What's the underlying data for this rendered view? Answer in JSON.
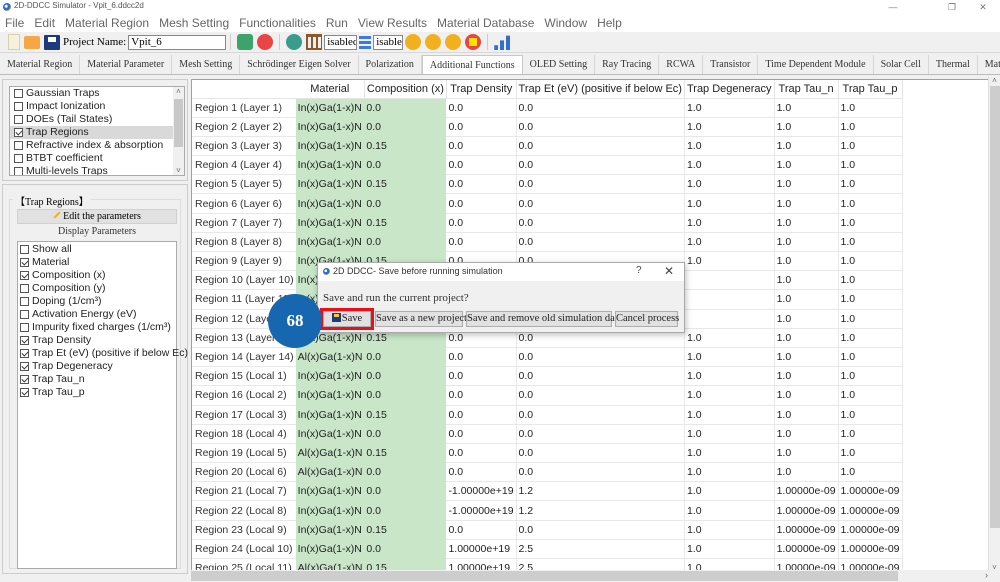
{
  "window": {
    "title": "2D-DDCC Simulator - Vpit_6.ddcc2d",
    "controls": {
      "minimize": "—",
      "maximize": "❐",
      "close": "✕"
    }
  },
  "menu": [
    "File",
    "Edit",
    "Material Region",
    "Mesh Setting",
    "Functionalities",
    "Run",
    "View Results",
    "Material Database",
    "Window",
    "Help"
  ],
  "toolbar": {
    "project_name_label": "Project Name:",
    "project_name_value": "Vpit_6",
    "dropdown1_value": "isabled",
    "dropdown2_value": "isabled",
    "icons": [
      "new-file-icon",
      "open-folder-icon",
      "save-icon",
      "refresh-mesh-icon",
      "reload-icon",
      "settings-icon",
      "parallel-icon",
      "list-icon",
      "run-icon",
      "run-all-icon",
      "run-batch-icon",
      "stop-icon",
      "chart-icon"
    ]
  },
  "tabs": [
    {
      "label": "Material Region",
      "active": false
    },
    {
      "label": "Material Parameter",
      "active": false
    },
    {
      "label": "Mesh Setting",
      "active": false
    },
    {
      "label": "Schrödinger Eigen Solver",
      "active": false
    },
    {
      "label": "Polarization",
      "active": false
    },
    {
      "label": "Additional Functions",
      "active": true
    },
    {
      "label": "OLED Setting",
      "active": false
    },
    {
      "label": "Ray Tracing",
      "active": false
    },
    {
      "label": "RCWA",
      "active": false
    },
    {
      "label": "Transistor",
      "active": false
    },
    {
      "label": "Time Dependent Module",
      "active": false
    },
    {
      "label": "Solar Cell",
      "active": false
    },
    {
      "label": "Thermal",
      "active": false
    },
    {
      "label": "Material Database",
      "active": false
    }
  ],
  "functions_list": [
    {
      "label": "Gaussian Traps",
      "checked": false,
      "selected": false
    },
    {
      "label": "Impact Ionization",
      "checked": false,
      "selected": false
    },
    {
      "label": "DOEs (Tail States)",
      "checked": false,
      "selected": false
    },
    {
      "label": "Trap Regions",
      "checked": true,
      "selected": true
    },
    {
      "label": "Refractive index & absorption",
      "checked": false,
      "selected": false
    },
    {
      "label": "BTBT coefficient",
      "checked": false,
      "selected": false
    },
    {
      "label": "Multi-levels Traps",
      "checked": false,
      "selected": false
    }
  ],
  "trap_panel": {
    "group_title": "【Trap Regions】",
    "edit_button": "Edit the parameters",
    "display_label": "Display Parameters",
    "display_params": [
      {
        "label": "Show all",
        "checked": false
      },
      {
        "label": "Material",
        "checked": true
      },
      {
        "label": "Composition (x)",
        "checked": true
      },
      {
        "label": "Composition (y)",
        "checked": false
      },
      {
        "label": "Doping (1/cm³)",
        "checked": false
      },
      {
        "label": "Activation Energy (eV)",
        "checked": false
      },
      {
        "label": "Impurity fixed charges (1/cm³)",
        "checked": false
      },
      {
        "label": "Trap Density",
        "checked": true
      },
      {
        "label": "Trap Et (eV) (positive if below Ec)",
        "checked": true
      },
      {
        "label": "Trap Degeneracy",
        "checked": true
      },
      {
        "label": "Trap Tau_n",
        "checked": true
      },
      {
        "label": "Trap Tau_p",
        "checked": true
      }
    ]
  },
  "table": {
    "columns": [
      "Material",
      "Composition (x)",
      "Trap Density",
      "Trap Et (eV) (positive if below Ec)",
      "Trap Degeneracy",
      "Trap Tau_n",
      "Trap Tau_p"
    ],
    "rows": [
      {
        "label": "Region 1 (Layer 1)",
        "cells": [
          "In(x)Ga(1-x)N",
          "0.0",
          "0.0",
          "0.0",
          "1.0",
          "1.0",
          "1.0"
        ]
      },
      {
        "label": "Region 2 (Layer 2)",
        "cells": [
          "In(x)Ga(1-x)N",
          "0.0",
          "0.0",
          "0.0",
          "1.0",
          "1.0",
          "1.0"
        ]
      },
      {
        "label": "Region 3 (Layer 3)",
        "cells": [
          "In(x)Ga(1-x)N",
          "0.15",
          "0.0",
          "0.0",
          "1.0",
          "1.0",
          "1.0"
        ]
      },
      {
        "label": "Region 4 (Layer 4)",
        "cells": [
          "In(x)Ga(1-x)N",
          "0.0",
          "0.0",
          "0.0",
          "1.0",
          "1.0",
          "1.0"
        ]
      },
      {
        "label": "Region 5 (Layer 5)",
        "cells": [
          "In(x)Ga(1-x)N",
          "0.15",
          "0.0",
          "0.0",
          "1.0",
          "1.0",
          "1.0"
        ]
      },
      {
        "label": "Region 6 (Layer 6)",
        "cells": [
          "In(x)Ga(1-x)N",
          "0.0",
          "0.0",
          "0.0",
          "1.0",
          "1.0",
          "1.0"
        ]
      },
      {
        "label": "Region 7 (Layer 7)",
        "cells": [
          "In(x)Ga(1-x)N",
          "0.15",
          "0.0",
          "0.0",
          "1.0",
          "1.0",
          "1.0"
        ]
      },
      {
        "label": "Region 8 (Layer 8)",
        "cells": [
          "In(x)Ga(1-x)N",
          "0.0",
          "0.0",
          "0.0",
          "1.0",
          "1.0",
          "1.0"
        ]
      },
      {
        "label": "Region 9 (Layer 9)",
        "cells": [
          "In(x)Ga(1-x)N",
          "0.15",
          "0.0",
          "0.0",
          "1.0",
          "1.0",
          "1.0"
        ]
      },
      {
        "label": "Region 10 (Layer 10)",
        "cells": [
          "In(x)Ga(1-x)N",
          "",
          "",
          "",
          "",
          "1.0",
          "1.0"
        ]
      },
      {
        "label": "Region 11 (Layer 11)",
        "cells": [
          "In(x)Ga(1-x)N",
          "",
          "",
          "",
          "",
          "1.0",
          "1.0"
        ]
      },
      {
        "label": "Region 12 (Layer 12)",
        "cells": [
          "In(x)Ga(1-x)N",
          "",
          "",
          "",
          "",
          "1.0",
          "1.0"
        ]
      },
      {
        "label": "Region 13 (Layer 13)",
        "cells": [
          "In(x)Ga(1-x)N",
          "0.15",
          "0.0",
          "0.0",
          "1.0",
          "1.0",
          "1.0"
        ]
      },
      {
        "label": "Region 14 (Layer 14)",
        "cells": [
          "Al(x)Ga(1-x)N",
          "0.0",
          "0.0",
          "0.0",
          "1.0",
          "1.0",
          "1.0"
        ]
      },
      {
        "label": "Region 15 (Local 1)",
        "cells": [
          "In(x)Ga(1-x)N",
          "0.0",
          "0.0",
          "0.0",
          "1.0",
          "1.0",
          "1.0"
        ]
      },
      {
        "label": "Region 16 (Local 2)",
        "cells": [
          "In(x)Ga(1-x)N",
          "0.0",
          "0.0",
          "0.0",
          "1.0",
          "1.0",
          "1.0"
        ]
      },
      {
        "label": "Region 17 (Local 3)",
        "cells": [
          "In(x)Ga(1-x)N",
          "0.15",
          "0.0",
          "0.0",
          "1.0",
          "1.0",
          "1.0"
        ]
      },
      {
        "label": "Region 18 (Local 4)",
        "cells": [
          "In(x)Ga(1-x)N",
          "0.0",
          "0.0",
          "0.0",
          "1.0",
          "1.0",
          "1.0"
        ]
      },
      {
        "label": "Region 19 (Local 5)",
        "cells": [
          "Al(x)Ga(1-x)N",
          "0.15",
          "0.0",
          "0.0",
          "1.0",
          "1.0",
          "1.0"
        ]
      },
      {
        "label": "Region 20 (Local 6)",
        "cells": [
          "Al(x)Ga(1-x)N",
          "0.0",
          "0.0",
          "0.0",
          "1.0",
          "1.0",
          "1.0"
        ]
      },
      {
        "label": "Region 21 (Local 7)",
        "cells": [
          "In(x)Ga(1-x)N",
          "0.0",
          "-1.00000e+19",
          "1.2",
          "1.0",
          "1.00000e-09",
          "1.00000e-09"
        ]
      },
      {
        "label": "Region 22 (Local 8)",
        "cells": [
          "In(x)Ga(1-x)N",
          "0.0",
          "-1.00000e+19",
          "1.2",
          "1.0",
          "1.00000e-09",
          "1.00000e-09"
        ]
      },
      {
        "label": "Region 23 (Local 9)",
        "cells": [
          "In(x)Ga(1-x)N",
          "0.15",
          "0.0",
          "0.0",
          "1.0",
          "1.00000e-09",
          "1.00000e-09"
        ]
      },
      {
        "label": "Region 24 (Local 10)",
        "cells": [
          "In(x)Ga(1-x)N",
          "0.0",
          "1.00000e+19",
          "2.5",
          "1.0",
          "1.00000e-09",
          "1.00000e-09"
        ]
      },
      {
        "label": "Region 25 (Local 11)",
        "cells": [
          "Al(x)Ga(1-x)N",
          "0.15",
          "1.00000e+19",
          "2.5",
          "1.0",
          "1.00000e-09",
          "1.00000e-09"
        ]
      }
    ]
  },
  "dialog": {
    "title": "2D DDCC- Save before running simulation",
    "help": "?",
    "close": "✕",
    "message": "Save and run the current project?",
    "buttons": {
      "save": "Save",
      "save_new": "Save as a new project",
      "save_remove": "Save and remove old simulation data",
      "cancel": "Cancel process"
    }
  },
  "step_badge": "68",
  "colors": {
    "highlight_green": "#c9e6c9",
    "badge_blue": "#1766b0",
    "highlight_red": "#e8101a"
  }
}
